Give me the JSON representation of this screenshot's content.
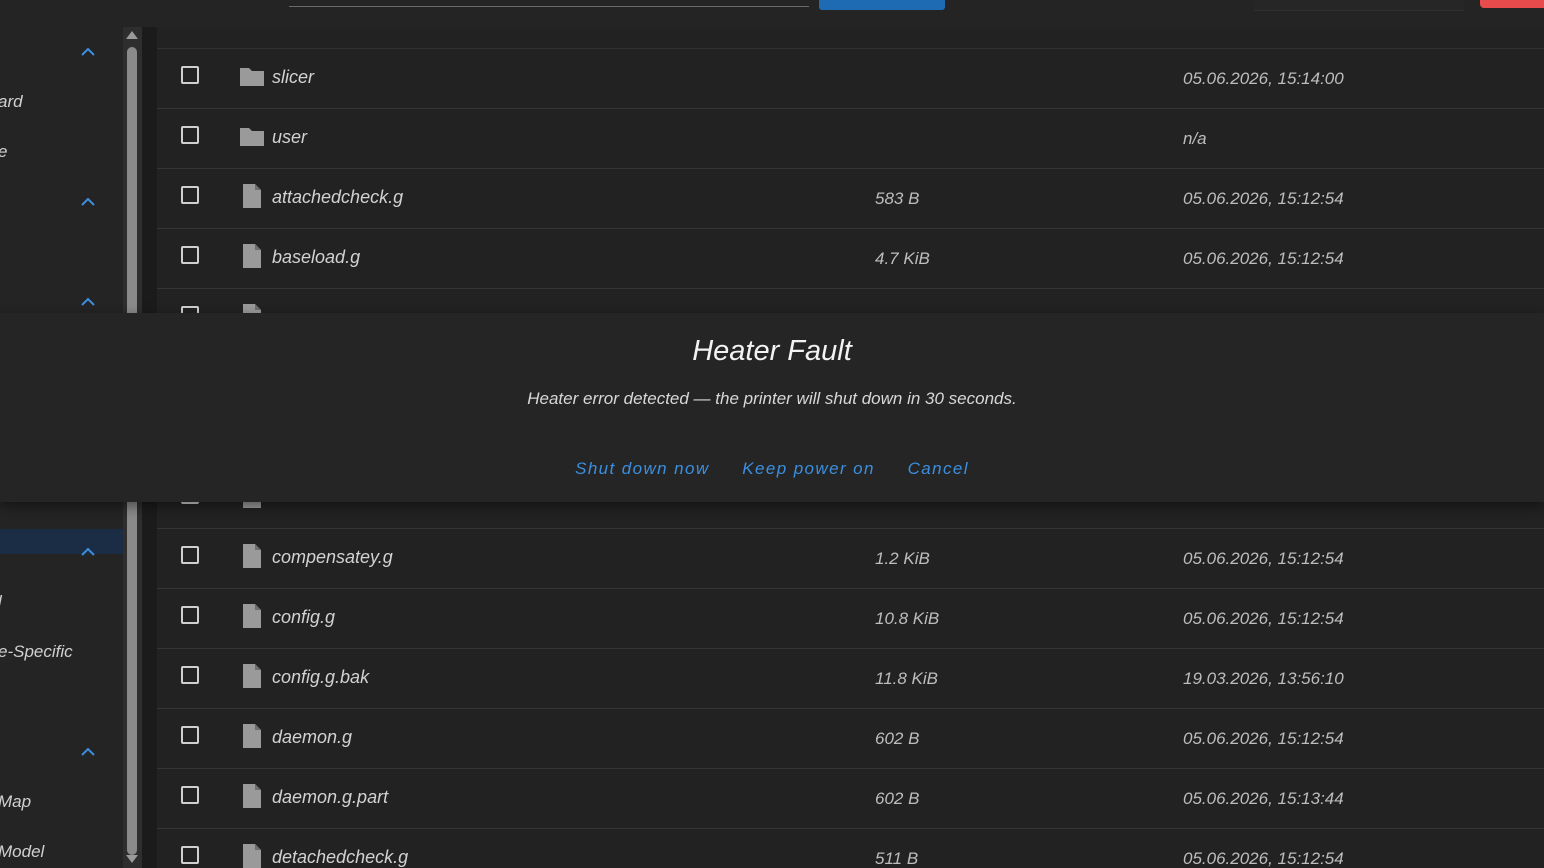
{
  "sidebar": {
    "labels": [
      "ard",
      "e",
      "l",
      "e-Specific",
      "Map",
      "Model"
    ]
  },
  "files": [
    {
      "name": "slicer",
      "type": "folder",
      "size": "",
      "date": "05.06.2026, 15:14:00"
    },
    {
      "name": "user",
      "type": "folder",
      "size": "",
      "date": "n/a"
    },
    {
      "name": "attachedcheck.g",
      "type": "file",
      "size": "583 B",
      "date": "05.06.2026, 15:12:54"
    },
    {
      "name": "baseload.g",
      "type": "file",
      "size": "4.7 KiB",
      "date": "05.06.2026, 15:12:54"
    },
    {
      "name": "compensatey.g",
      "type": "file",
      "size": "1.2 KiB",
      "date": "05.06.2026, 15:12:54"
    },
    {
      "name": "config.g",
      "type": "file",
      "size": "10.8 KiB",
      "date": "05.06.2026, 15:12:54"
    },
    {
      "name": "config.g.bak",
      "type": "file",
      "size": "11.8 KiB",
      "date": "19.03.2026, 13:56:10"
    },
    {
      "name": "daemon.g",
      "type": "file",
      "size": "602 B",
      "date": "05.06.2026, 15:12:54"
    },
    {
      "name": "daemon.g.part",
      "type": "file",
      "size": "602 B",
      "date": "05.06.2026, 15:13:44"
    },
    {
      "name": "detachedcheck.g",
      "type": "file",
      "size": "511 B",
      "date": "05.06.2026, 15:12:54"
    }
  ],
  "dialog": {
    "title": "Heater Fault",
    "message": "Heater error detected — the printer will shut down in 30 seconds.",
    "actions": {
      "shutdown": "Shut down now",
      "keep": "Keep power on",
      "cancel": "Cancel"
    }
  },
  "colors": {
    "accent": "#3b8fe0",
    "danger": "#e84b4b",
    "primary": "#1e6bb3"
  }
}
